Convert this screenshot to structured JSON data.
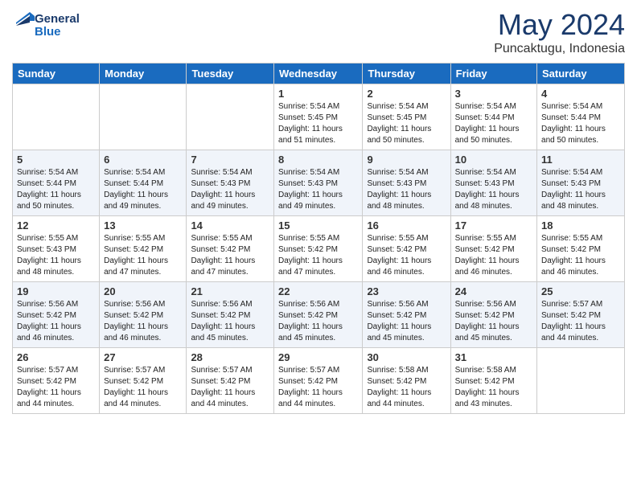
{
  "header": {
    "logo_line1": "General",
    "logo_line2": "Blue",
    "title": "May 2024",
    "location": "Puncaktugu, Indonesia"
  },
  "weekdays": [
    "Sunday",
    "Monday",
    "Tuesday",
    "Wednesday",
    "Thursday",
    "Friday",
    "Saturday"
  ],
  "weeks": [
    [
      {
        "day": "",
        "info": ""
      },
      {
        "day": "",
        "info": ""
      },
      {
        "day": "",
        "info": ""
      },
      {
        "day": "1",
        "info": "Sunrise: 5:54 AM\nSunset: 5:45 PM\nDaylight: 11 hours\nand 51 minutes."
      },
      {
        "day": "2",
        "info": "Sunrise: 5:54 AM\nSunset: 5:45 PM\nDaylight: 11 hours\nand 50 minutes."
      },
      {
        "day": "3",
        "info": "Sunrise: 5:54 AM\nSunset: 5:44 PM\nDaylight: 11 hours\nand 50 minutes."
      },
      {
        "day": "4",
        "info": "Sunrise: 5:54 AM\nSunset: 5:44 PM\nDaylight: 11 hours\nand 50 minutes."
      }
    ],
    [
      {
        "day": "5",
        "info": "Sunrise: 5:54 AM\nSunset: 5:44 PM\nDaylight: 11 hours\nand 50 minutes."
      },
      {
        "day": "6",
        "info": "Sunrise: 5:54 AM\nSunset: 5:44 PM\nDaylight: 11 hours\nand 49 minutes."
      },
      {
        "day": "7",
        "info": "Sunrise: 5:54 AM\nSunset: 5:43 PM\nDaylight: 11 hours\nand 49 minutes."
      },
      {
        "day": "8",
        "info": "Sunrise: 5:54 AM\nSunset: 5:43 PM\nDaylight: 11 hours\nand 49 minutes."
      },
      {
        "day": "9",
        "info": "Sunrise: 5:54 AM\nSunset: 5:43 PM\nDaylight: 11 hours\nand 48 minutes."
      },
      {
        "day": "10",
        "info": "Sunrise: 5:54 AM\nSunset: 5:43 PM\nDaylight: 11 hours\nand 48 minutes."
      },
      {
        "day": "11",
        "info": "Sunrise: 5:54 AM\nSunset: 5:43 PM\nDaylight: 11 hours\nand 48 minutes."
      }
    ],
    [
      {
        "day": "12",
        "info": "Sunrise: 5:55 AM\nSunset: 5:43 PM\nDaylight: 11 hours\nand 48 minutes."
      },
      {
        "day": "13",
        "info": "Sunrise: 5:55 AM\nSunset: 5:42 PM\nDaylight: 11 hours\nand 47 minutes."
      },
      {
        "day": "14",
        "info": "Sunrise: 5:55 AM\nSunset: 5:42 PM\nDaylight: 11 hours\nand 47 minutes."
      },
      {
        "day": "15",
        "info": "Sunrise: 5:55 AM\nSunset: 5:42 PM\nDaylight: 11 hours\nand 47 minutes."
      },
      {
        "day": "16",
        "info": "Sunrise: 5:55 AM\nSunset: 5:42 PM\nDaylight: 11 hours\nand 46 minutes."
      },
      {
        "day": "17",
        "info": "Sunrise: 5:55 AM\nSunset: 5:42 PM\nDaylight: 11 hours\nand 46 minutes."
      },
      {
        "day": "18",
        "info": "Sunrise: 5:55 AM\nSunset: 5:42 PM\nDaylight: 11 hours\nand 46 minutes."
      }
    ],
    [
      {
        "day": "19",
        "info": "Sunrise: 5:56 AM\nSunset: 5:42 PM\nDaylight: 11 hours\nand 46 minutes."
      },
      {
        "day": "20",
        "info": "Sunrise: 5:56 AM\nSunset: 5:42 PM\nDaylight: 11 hours\nand 46 minutes."
      },
      {
        "day": "21",
        "info": "Sunrise: 5:56 AM\nSunset: 5:42 PM\nDaylight: 11 hours\nand 45 minutes."
      },
      {
        "day": "22",
        "info": "Sunrise: 5:56 AM\nSunset: 5:42 PM\nDaylight: 11 hours\nand 45 minutes."
      },
      {
        "day": "23",
        "info": "Sunrise: 5:56 AM\nSunset: 5:42 PM\nDaylight: 11 hours\nand 45 minutes."
      },
      {
        "day": "24",
        "info": "Sunrise: 5:56 AM\nSunset: 5:42 PM\nDaylight: 11 hours\nand 45 minutes."
      },
      {
        "day": "25",
        "info": "Sunrise: 5:57 AM\nSunset: 5:42 PM\nDaylight: 11 hours\nand 44 minutes."
      }
    ],
    [
      {
        "day": "26",
        "info": "Sunrise: 5:57 AM\nSunset: 5:42 PM\nDaylight: 11 hours\nand 44 minutes."
      },
      {
        "day": "27",
        "info": "Sunrise: 5:57 AM\nSunset: 5:42 PM\nDaylight: 11 hours\nand 44 minutes."
      },
      {
        "day": "28",
        "info": "Sunrise: 5:57 AM\nSunset: 5:42 PM\nDaylight: 11 hours\nand 44 minutes."
      },
      {
        "day": "29",
        "info": "Sunrise: 5:57 AM\nSunset: 5:42 PM\nDaylight: 11 hours\nand 44 minutes."
      },
      {
        "day": "30",
        "info": "Sunrise: 5:58 AM\nSunset: 5:42 PM\nDaylight: 11 hours\nand 44 minutes."
      },
      {
        "day": "31",
        "info": "Sunrise: 5:58 AM\nSunset: 5:42 PM\nDaylight: 11 hours\nand 43 minutes."
      },
      {
        "day": "",
        "info": ""
      }
    ]
  ]
}
